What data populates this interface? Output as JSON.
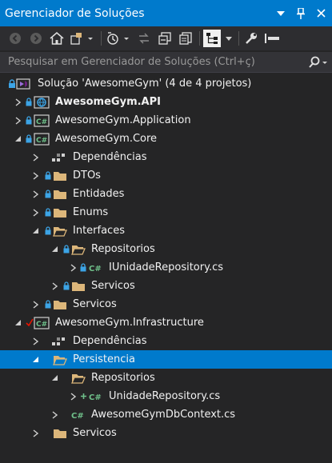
{
  "window": {
    "title": "Gerenciador de Soluções",
    "title_buttons": [
      "dropdown-arrow-icon",
      "pin-icon",
      "close-icon"
    ]
  },
  "toolbar": {
    "buttons": [
      "back-icon",
      "forward-icon",
      "home-icon",
      "switch-views-icon",
      "pending-changes-filter-icon",
      "sync-active-document-icon",
      "collapse-all-icon",
      "show-all-files-icon",
      "preview-selected-items-icon",
      "properties-icon",
      "auto-hide-icon"
    ]
  },
  "search": {
    "placeholder": "Pesquisar em Gerenciador de Soluções (Ctrl+ç)"
  },
  "colors": {
    "title_bar": "#007acc",
    "selection": "#007acc",
    "background": "#252526",
    "folder": "#dcb67a",
    "lock": "#3ca4e6",
    "csharp": "#6fc08a",
    "checkmark": "#e51400"
  },
  "tree": {
    "solution": "Solução 'AwesomeGym' (4 de 4 projetos)",
    "api": "AwesomeGym.API",
    "application": "AwesomeGym.Application",
    "core": "AwesomeGym.Core",
    "core_dependencias": "Dependências",
    "core_dtos": "DTOs",
    "core_entidades": "Entidades",
    "core_enums": "Enums",
    "core_interfaces": "Interfaces",
    "core_repositorios": "Repositorios",
    "core_iunidade": "IUnidadeRepository.cs",
    "core_int_servicos": "Servicos",
    "core_servicos": "Servicos",
    "infrastructure": "AwesomeGym.Infrastructure",
    "infra_dependencias": "Dependências",
    "persistencia": "Persistencia",
    "infra_repositorios": "Repositorios",
    "unidade_repo": "UnidadeRepository.cs",
    "dbcontext": "AwesomeGymDbContext.cs",
    "infra_servicos": "Servicos"
  }
}
